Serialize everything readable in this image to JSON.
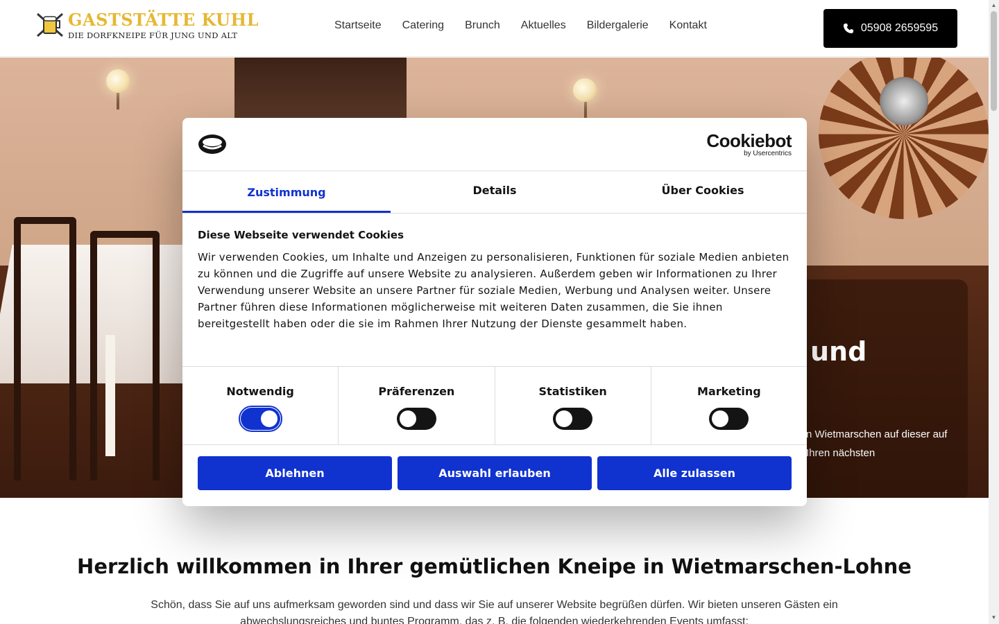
{
  "header": {
    "logo_title": "GASTSTÄTTE KUHL",
    "logo_subtitle": "DIE DORFKNEIPE FÜR JUNG UND ALT",
    "nav": [
      "Startseite",
      "Catering",
      "Brunch",
      "Aktuelles",
      "Bildergalerie",
      "Kontakt"
    ],
    "phone": "05908 2659595"
  },
  "hero": {
    "heading_fragment": "und",
    "text_fragment": "n Wietmarschen auf dieser auf Ihren nächsten"
  },
  "main": {
    "welcome_heading": "Herzlich willkommen in Ihrer gemütlichen Kneipe in Wietmarschen-Lohne",
    "intro_text": "Schön, dass Sie auf uns aufmerksam geworden sind und dass wir Sie auf unserer Website begrüßen dürfen. Wir bieten unseren Gästen ein abwechslungsreiches und buntes Programm, das z. B. die folgenden wiederkehrenden Events umfasst:"
  },
  "cookie": {
    "brand_name": "Cookiebot",
    "brand_sub": "by Usercentrics",
    "tabs": [
      "Zustimmung",
      "Details",
      "Über Cookies"
    ],
    "heading": "Diese Webseite verwendet Cookies",
    "text": "Wir verwenden Cookies, um Inhalte und Anzeigen zu personalisieren, Funktionen für soziale Medien anbieten zu können und die Zugriffe auf unsere Website zu analysieren. Außerdem geben wir Informationen zu Ihrer Verwendung unserer Website an unsere Partner für soziale Medien, Werbung und Analysen weiter. Unsere Partner führen diese Informationen möglicherweise mit weiteren Daten zusammen, die Sie ihnen bereitgestellt haben oder die sie im Rahmen Ihrer Nutzung der Dienste gesammelt haben.",
    "toggles": [
      {
        "label": "Notwendig",
        "on": true
      },
      {
        "label": "Präferenzen",
        "on": false
      },
      {
        "label": "Statistiken",
        "on": false
      },
      {
        "label": "Marketing",
        "on": false
      }
    ],
    "buttons": [
      "Ablehnen",
      "Auswahl erlauben",
      "Alle zulassen"
    ],
    "accent_color": "#1032cf"
  }
}
